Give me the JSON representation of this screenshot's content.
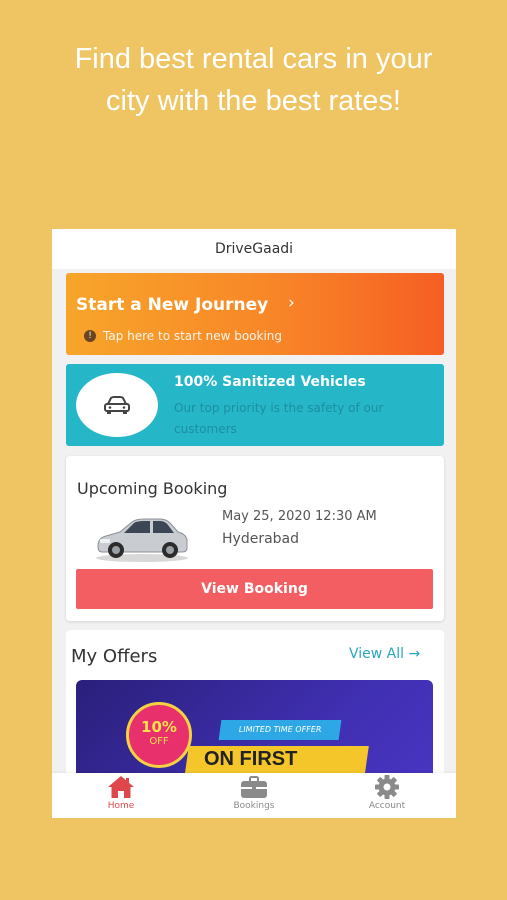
{
  "headline": {
    "line1": "Find best rental cars in your",
    "line2": "city with the best rates!"
  },
  "app": {
    "title": "DriveGaadi"
  },
  "journey": {
    "title": "Start a New Journey",
    "chevron": "›",
    "subtitle": "Tap here to start new booking"
  },
  "sanitized": {
    "title": "100% Sanitized Vehicles",
    "subtitle": "Our top priority is the safety of our customers"
  },
  "upcoming": {
    "title": "Upcoming Booking",
    "datetime": "May 25, 2020 12:30 AM",
    "city": "Hyderabad",
    "button_label": "View Booking"
  },
  "offers": {
    "title": "My Offers",
    "view_all": "View All",
    "banner": {
      "discount": "10%",
      "off": "OFF",
      "tag": "LIMITED TIME OFFER",
      "headline": "ON FIRST"
    }
  },
  "bottom_nav": [
    {
      "label": "Home",
      "icon": "home-icon",
      "active": true
    },
    {
      "label": "Bookings",
      "icon": "briefcase-icon",
      "active": false
    },
    {
      "label": "Account",
      "icon": "gear-icon",
      "active": false
    }
  ],
  "colors": {
    "background": "#efc564",
    "journey_orange": "#f88628",
    "sanitized_teal": "#25b6c8",
    "button_red": "#f25e62",
    "link_teal": "#2aa6bd",
    "active_nav": "#e0474c",
    "inactive_nav": "#8a8a8a"
  }
}
